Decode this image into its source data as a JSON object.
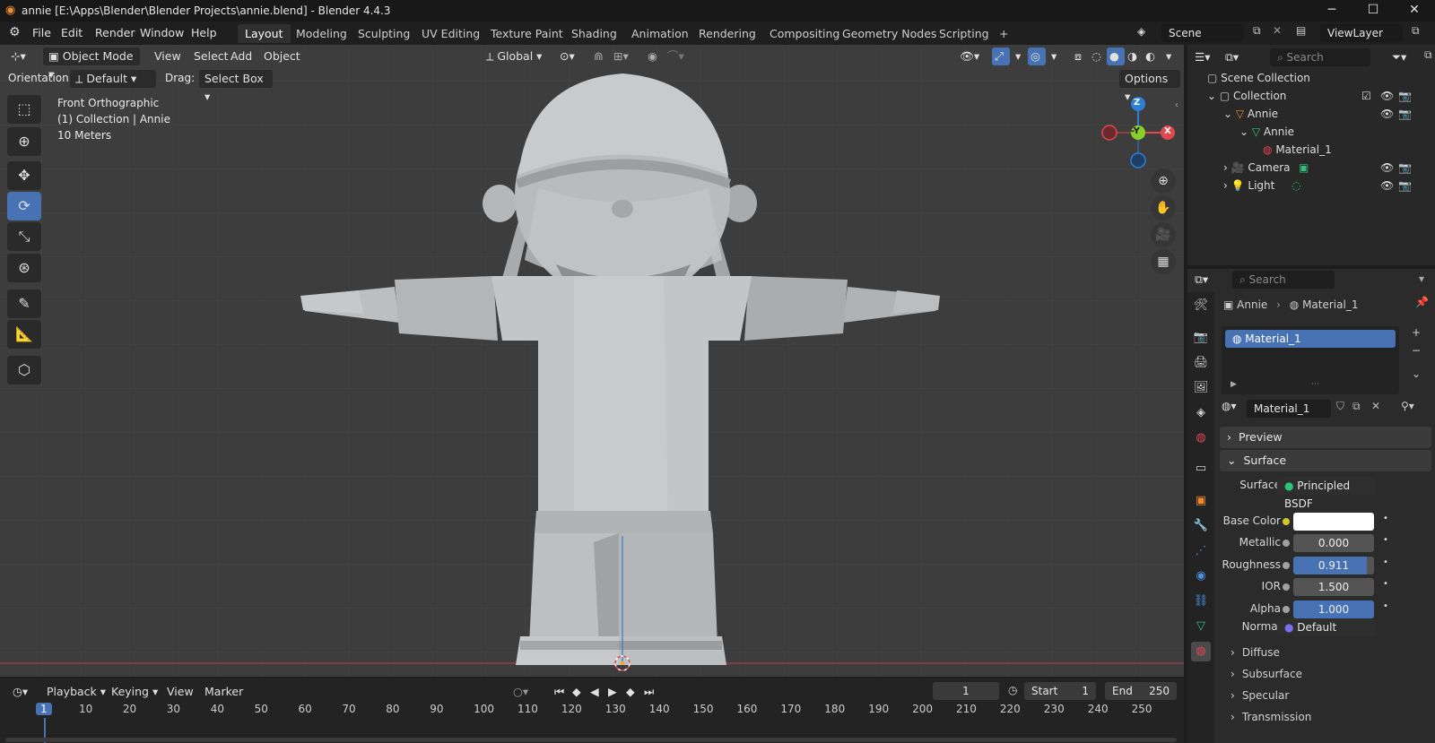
{
  "window": {
    "title": "annie [E:\\Apps\\Blender\\Blender Projects\\annie.blend] - Blender 4.4.3",
    "minimize": "─",
    "maximize": "☐",
    "close": "✕"
  },
  "menu": [
    "File",
    "Edit",
    "Render",
    "Window",
    "Help"
  ],
  "workspaces": [
    "Layout",
    "Modeling",
    "Sculpting",
    "UV Editing",
    "Texture Paint",
    "Shading",
    "Animation",
    "Rendering",
    "Compositing",
    "Geometry Nodes",
    "Scripting"
  ],
  "add_workspace": "+",
  "scene": {
    "name": "Scene",
    "viewlayer": "ViewLayer"
  },
  "viewport": {
    "mode": "Object Mode",
    "menus": [
      "View",
      "Select",
      "Add",
      "Object"
    ],
    "transform": "Global",
    "orientation_label": "Orientation:",
    "orientation": "Default",
    "drag_label": "Drag:",
    "drag": "Select Box",
    "options": "Options",
    "overlay_lines": [
      "Front Orthographic",
      "(1) Collection | Annie",
      "10 Meters"
    ],
    "gizmo": {
      "z": "Z",
      "y": "-Y",
      "x": "X"
    }
  },
  "outliner": {
    "search_placeholder": "Search",
    "rows": [
      {
        "label": "Scene Collection"
      },
      {
        "label": "Collection"
      },
      {
        "label": "Annie"
      },
      {
        "label": "Annie"
      },
      {
        "label": "Material_1"
      },
      {
        "label": "Camera"
      },
      {
        "label": "Light"
      }
    ]
  },
  "properties": {
    "search_placeholder": "Search",
    "breadcrumb": [
      "Annie",
      "Material_1"
    ],
    "slot": "Material_1",
    "material_name": "Material_1",
    "panels": {
      "preview": "Preview",
      "surface": "Surface",
      "diffuse": "Diffuse",
      "subsurface": "Subsurface",
      "specular": "Specular",
      "transmission": "Transmission"
    },
    "surface": {
      "label": "Surface",
      "value": "Principled BSDF"
    },
    "fields": [
      {
        "label": "Base Color",
        "value": "",
        "color": "#ffffff"
      },
      {
        "label": "Metallic",
        "value": "0.000",
        "fill": 0.0
      },
      {
        "label": "Roughness",
        "value": "0.911",
        "fill": 0.911
      },
      {
        "label": "IOR",
        "value": "1.500",
        "fill": 0.0
      },
      {
        "label": "Alpha",
        "value": "1.000",
        "fill": 1.0
      }
    ],
    "normal": {
      "label": "Normal",
      "value": "Default"
    }
  },
  "timeline": {
    "menus": [
      "Playback",
      "Keying",
      "View",
      "Marker"
    ],
    "current_frame": "1",
    "start_label": "Start",
    "start": "1",
    "end_label": "End",
    "end": "250",
    "ticks": [
      "1",
      "10",
      "20",
      "30",
      "40",
      "50",
      "60",
      "70",
      "80",
      "90",
      "100",
      "110",
      "120",
      "130",
      "140",
      "150",
      "160",
      "170",
      "180",
      "190",
      "200",
      "210",
      "220",
      "230",
      "240",
      "250"
    ]
  },
  "colors": {
    "accent": "#4772b3",
    "x_axis": "#e0484f",
    "y_axis": "#8bd02a",
    "z_axis": "#2f7fd5"
  }
}
